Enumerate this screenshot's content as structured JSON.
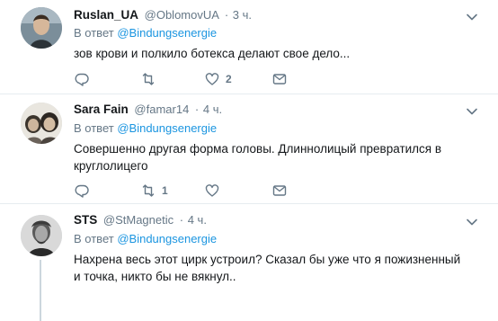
{
  "tweets": [
    {
      "name": "Ruslan_UA",
      "handle": "@OblomovUA",
      "dot": "·",
      "time": "3 ч.",
      "reply_prefix": "В ответ",
      "reply_mention": "@Bindungsenergie",
      "text": "зов крови и полкило ботекса делают свое дело...",
      "likes": "2",
      "retweets": "",
      "replies": ""
    },
    {
      "name": "Sara Fain",
      "handle": "@famar14",
      "dot": "·",
      "time": "4 ч.",
      "reply_prefix": "В ответ",
      "reply_mention": "@Bindungsenergie",
      "text": "Совершенно другая форма головы. Длиннолицый превратился в круглолицего",
      "likes": "",
      "retweets": "1",
      "replies": ""
    },
    {
      "name": "STS",
      "handle": "@StMagnetic",
      "dot": "·",
      "time": "4 ч.",
      "reply_prefix": "В ответ",
      "reply_mention": "@Bindungsenergie",
      "text": "Нахрена весь этот цирк устроил? Сказал бы уже что я пожизненный и точка, никто бы не вякнул..",
      "likes": "",
      "retweets": "",
      "replies": ""
    }
  ],
  "colors": {
    "text": "#14171a",
    "muted": "#657786",
    "link": "#1b95e0",
    "divider": "#e6ecf0",
    "thread_line": "#ccd6dd"
  },
  "icons": {
    "reply": "reply-icon",
    "retweet": "retweet-icon",
    "like": "heart-icon",
    "direct_message": "envelope-icon",
    "more": "chevron-down-icon"
  }
}
